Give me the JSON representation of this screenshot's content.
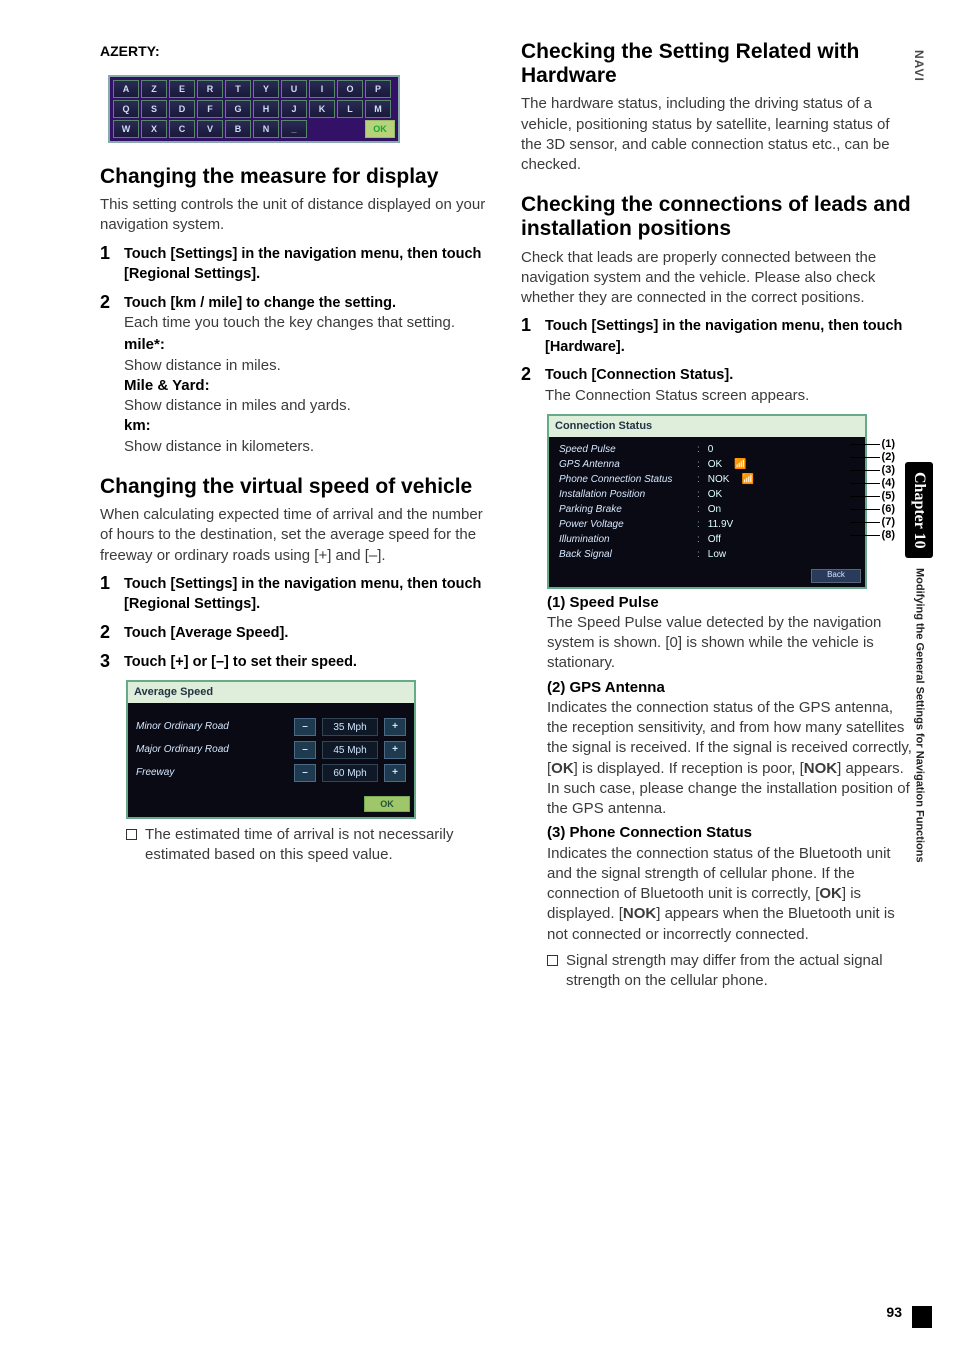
{
  "side": {
    "navi": "NAVI",
    "chapter": "Chapter 10",
    "sub": "Modifying the General Settings for Navigation Functions"
  },
  "page_number": "93",
  "left": {
    "azerty_label": "AZERTY:",
    "kbd": {
      "row1": [
        "A",
        "Z",
        "E",
        "R",
        "T",
        "Y",
        "U",
        "I",
        "O",
        "P"
      ],
      "row2": [
        "Q",
        "S",
        "D",
        "F",
        "G",
        "H",
        "J",
        "K",
        "L",
        "M"
      ],
      "row3": [
        "W",
        "X",
        "C",
        "V",
        "B",
        "N",
        "_"
      ],
      "ok": "OK"
    },
    "measure": {
      "heading": "Changing the measure for display",
      "intro": "This setting controls the unit of distance displayed on your navigation system.",
      "step1": "Touch [Settings] in the navigation menu, then touch [Regional Settings].",
      "step2_bold": "Touch [km / mile] to change the setting.",
      "step2_reg": "Each time you touch the key changes that setting.",
      "mile_label": "mile*:",
      "mile_desc": "Show distance in miles.",
      "mileyard_label": "Mile & Yard:",
      "mileyard_desc": "Show distance in miles and yards.",
      "km_label": "km:",
      "km_desc": "Show distance in kilometers."
    },
    "vspeed": {
      "heading": "Changing the virtual speed of vehicle",
      "intro": "When calculating expected time of arrival and the number of hours to the destination, set the average speed for the freeway or ordinary roads using [+] and [–].",
      "step1": "Touch [Settings] in the navigation menu, then touch [Regional Settings].",
      "step2": "Touch [Average Speed].",
      "step3": "Touch [+] or [–] to set their speed.",
      "screenshot": {
        "title": "Average Speed",
        "rows": [
          {
            "label": "Minor Ordinary Road",
            "value": "35 Mph"
          },
          {
            "label": "Major Ordinary Road",
            "value": "45 Mph"
          },
          {
            "label": "Freeway",
            "value": "60 Mph"
          }
        ],
        "minus": "–",
        "plus": "+",
        "ok": "OK"
      },
      "note": "The estimated time of arrival is not necessarily estimated based on this speed value."
    }
  },
  "right": {
    "hw": {
      "heading": "Checking the Setting Related with Hardware",
      "intro": "The hardware status, including the driving status of a vehicle, positioning status by satellite, learning status of the 3D sensor, and cable connection status etc., can be checked."
    },
    "conn": {
      "heading": "Checking the connections of leads and installation positions",
      "intro": "Check that leads are properly connected between the navigation system and the vehicle. Please also check whether they are connected in the correct positions.",
      "step1": "Touch [Settings] in the navigation menu, then touch [Hardware].",
      "step2_bold": "Touch [Connection Status].",
      "step2_reg": "The Connection Status screen appears.",
      "screenshot": {
        "title": "Connection Status",
        "rows": [
          {
            "label": "Speed Pulse",
            "value": "0"
          },
          {
            "label": "GPS Antenna",
            "value": "OK",
            "ant": "📶"
          },
          {
            "label": "Phone Connection Status",
            "value": "NOK",
            "ant": "📶"
          },
          {
            "label": "Installation Position",
            "value": "OK"
          },
          {
            "label": "Parking Brake",
            "value": "On"
          },
          {
            "label": "Power Voltage",
            "value": "11.9V"
          },
          {
            "label": "Illumination",
            "value": "Off"
          },
          {
            "label": "Back Signal",
            "value": "Low"
          }
        ],
        "back": "Back",
        "callouts": [
          "(1)",
          "(2)",
          "(3)",
          "(4)",
          "(5)",
          "(6)",
          "(7)",
          "(8)"
        ]
      },
      "d1_label": "(1) Speed Pulse",
      "d1_body": "The Speed Pulse value detected by the navigation system is shown. [0] is shown while the vehicle is stationary.",
      "d2_label": "(2) GPS Antenna",
      "d2_body_a": "Indicates the connection status of the GPS antenna, the reception sensitivity, and from how many satellites the signal is received. If the signal is received correctly, [",
      "d2_ok": "OK",
      "d2_body_b": "] is displayed. If reception is poor, [",
      "d2_nok": "NOK",
      "d2_body_c": "] appears. In such case, please change the installation position of the GPS antenna.",
      "d3_label": "(3) Phone Connection Status",
      "d3_body_a": "Indicates the connection status of the Bluetooth unit and the signal strength of cellular phone. If the connection of Bluetooth unit is correctly, [",
      "d3_ok": "OK",
      "d3_body_b": "] is displayed. [",
      "d3_nok": "NOK",
      "d3_body_c": "] appears when the Bluetooth unit is not connected or incorrectly connected.",
      "d3_note": "Signal strength may differ from the actual signal strength on the cellular phone."
    }
  }
}
